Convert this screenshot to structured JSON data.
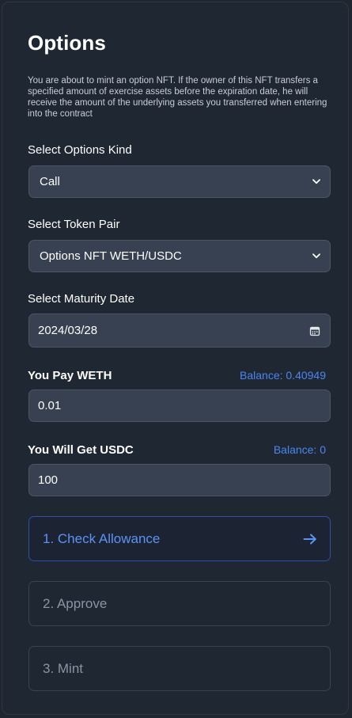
{
  "header": {
    "title": "Options",
    "description": "You are about to mint an option NFT. If the owner of this NFT transfers a specified amount of exercise assets before the expiration date, he will receive the amount of the underlying assets you transferred when entering into the contract"
  },
  "options_kind": {
    "label": "Select Options Kind",
    "value": "Call"
  },
  "token_pair": {
    "label": "Select Token Pair",
    "value": "Options NFT WETH/USDC"
  },
  "maturity": {
    "label": "Select Maturity Date",
    "value": "2024/03/28"
  },
  "pay": {
    "label": "You Pay WETH",
    "balance": "Balance: 0.40949",
    "value": "0.01"
  },
  "get": {
    "label": "You Will Get USDC",
    "balance": "Balance: 0",
    "value": "100"
  },
  "steps": {
    "check_allowance": "1. Check Allowance",
    "approve": "2. Approve",
    "mint": "3. Mint"
  },
  "icons": {
    "select_chevron": "chevron-down-icon",
    "calendar": "calendar-icon",
    "arrow": "arrow-right-icon"
  },
  "colors": {
    "accent": "#4a86f0",
    "field_bg": "#374151",
    "panel_bg": "#1f2732"
  }
}
